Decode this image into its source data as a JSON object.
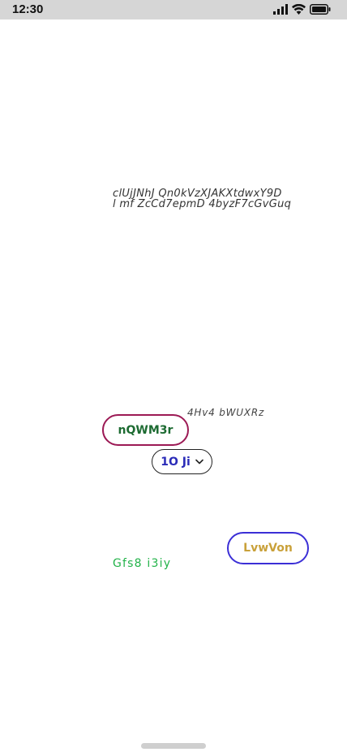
{
  "status_bar": {
    "time": "12:30",
    "icons": [
      "signal-icon",
      "wifi-icon",
      "battery-icon"
    ]
  },
  "content": {
    "paragraph_lines": [
      "clUjJNhJ Qn0kVzXJAKXtdwxY9D",
      "l mf ZcCd7epmD 4byzF7cGvGuq"
    ],
    "caption": "4Hv4 bWUXRz",
    "primary_button_label": "nQWM3r",
    "dropdown": {
      "selected": "1O Ji"
    },
    "green_text": "Gfs8 i3iy",
    "secondary_button_label": "LvwVon"
  },
  "colors": {
    "primary_border": "#9c1a55",
    "primary_text": "#1d6b32",
    "dropdown_text": "#2b2cb8",
    "green_text": "#23b34a",
    "secondary_border": "#3b2fd6",
    "secondary_text": "#c9a13a"
  }
}
